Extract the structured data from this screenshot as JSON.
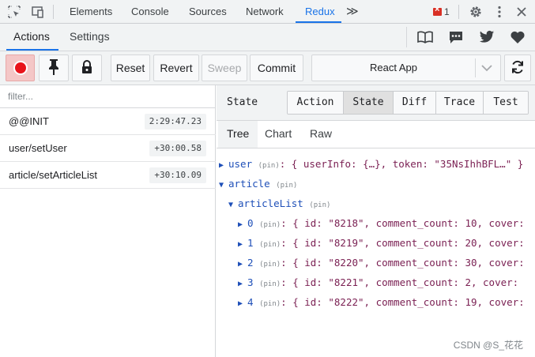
{
  "devtools": {
    "tabs": [
      {
        "label": "Elements"
      },
      {
        "label": "Console"
      },
      {
        "label": "Sources"
      },
      {
        "label": "Network"
      },
      {
        "label": "Redux",
        "active": true
      }
    ],
    "more_label": "≫",
    "error_count": "1",
    "icons": [
      "inspect-element-icon",
      "device-toggle-icon",
      "settings-icon",
      "more-options-icon",
      "close-icon"
    ]
  },
  "redux": {
    "tabs": [
      {
        "label": "Actions",
        "active": true
      },
      {
        "label": "Settings"
      }
    ],
    "header_icons": [
      "book-icon",
      "chat-icon",
      "twitter-icon",
      "heart-icon"
    ]
  },
  "toolbar": {
    "reset_label": "Reset",
    "revert_label": "Revert",
    "sweep_label": "Sweep",
    "commit_label": "Commit",
    "instance_label": "React App"
  },
  "filter": {
    "placeholder": "filter..."
  },
  "actions": [
    {
      "name": "@@INIT",
      "time": "2:29:47.23"
    },
    {
      "name": "user/setUser",
      "time": "+30:00.58"
    },
    {
      "name": "article/setArticleList",
      "time": "+30:10.09"
    }
  ],
  "monitor": {
    "title": "State",
    "tabs": [
      "Action",
      "State",
      "Diff",
      "Trace",
      "Test"
    ],
    "active_tab": "State",
    "sub_tabs": [
      "Tree",
      "Chart",
      "Raw"
    ],
    "active_sub_tab": "Tree"
  },
  "tree": {
    "pin_label": "(pin)",
    "user": {
      "key": "user",
      "value": ": { userInfo: {…}, token: \"35NsIhhBFL…\" }"
    },
    "article": {
      "key": "article"
    },
    "articleList": {
      "key": "articleList"
    },
    "items": [
      {
        "key": "0",
        "value": ": { id: \"8218\", comment_count: 10, cover:"
      },
      {
        "key": "1",
        "value": ": { id: \"8219\", comment_count: 20, cover:"
      },
      {
        "key": "2",
        "value": ": { id: \"8220\", comment_count: 30, cover:"
      },
      {
        "key": "3",
        "value": ": { id: \"8221\", comment_count: 2, cover:"
      },
      {
        "key": "4",
        "value": ": { id: \"8222\", comment_count: 19, cover:"
      }
    ]
  },
  "watermark": "CSDN @S_花花"
}
